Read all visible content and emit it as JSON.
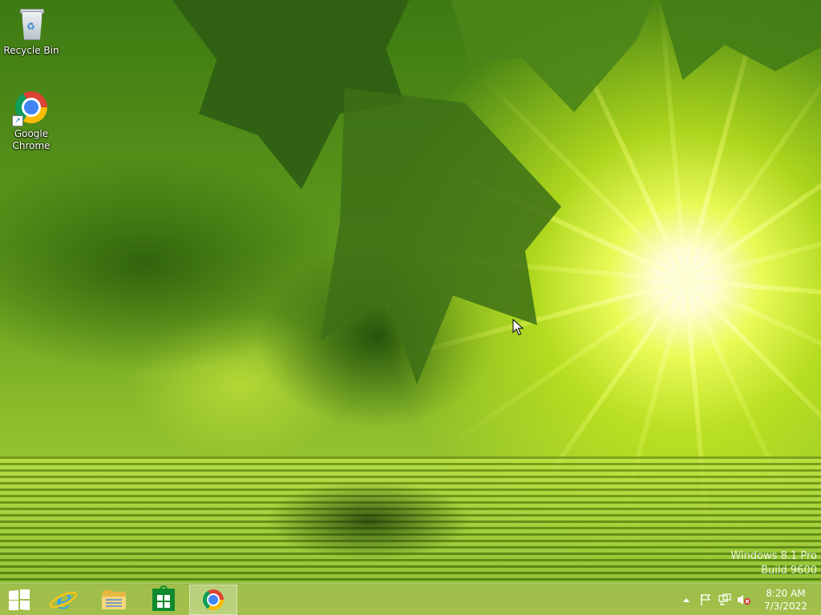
{
  "desktop": {
    "icons": [
      {
        "label": "Recycle Bin",
        "icon": "recycle-bin-icon"
      },
      {
        "label": "Google\nChrome",
        "icon": "chrome-icon"
      }
    ],
    "watermark": {
      "line1": "Windows 8.1 Pro",
      "line2": "Build 9600"
    }
  },
  "taskbar": {
    "apps": [
      {
        "name": "Start",
        "icon": "windows-logo-icon",
        "active": false
      },
      {
        "name": "Internet Explorer",
        "icon": "internet-explorer-icon",
        "active": false
      },
      {
        "name": "File Explorer",
        "icon": "file-explorer-icon",
        "active": false
      },
      {
        "name": "Store",
        "icon": "store-icon",
        "active": false
      },
      {
        "name": "Google Chrome",
        "icon": "chrome-icon",
        "active": true
      }
    ],
    "tray": {
      "icons": [
        "show-hidden-icons-icon",
        "action-center-flag-icon",
        "network-icon",
        "volume-muted-icon"
      ],
      "clock": {
        "time": "8:20 AM",
        "date": "7/3/2022"
      }
    }
  },
  "colors": {
    "taskbar": "#96af5a",
    "accent": "#4285f4"
  }
}
